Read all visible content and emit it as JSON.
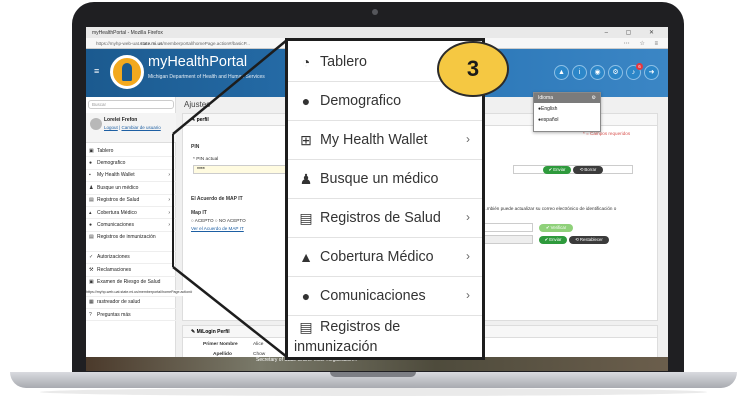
{
  "browser": {
    "window_title": "myHealthPortal - Mozilla Firefox",
    "window_controls": "– ▢ ✕",
    "url_prefix": "https://myhp-web-uat.",
    "url_domain": "state.mi.us",
    "url_path": "/memberportal/homePage.action#/basicP..."
  },
  "header": {
    "app_title": "myHealthPortal",
    "app_subtitle": "Michigan Department of Health and Human Services",
    "notification_count": "6"
  },
  "language_dropdown": {
    "title": "Idioma",
    "options": [
      "English",
      "español"
    ]
  },
  "sidebar": {
    "search_placeholder": "Buscar",
    "user_name": "Lorelei Frefon",
    "user_link_1": "Logout",
    "user_link_sep": "|",
    "user_link_2": "Cambiar de usuario",
    "items": [
      {
        "icon": "dashboard-icon",
        "label": "Tablero"
      },
      {
        "icon": "users-icon",
        "label": "Demografico"
      },
      {
        "icon": "wallet-icon",
        "label": "My Health Wallet",
        "arrow": "›"
      },
      {
        "icon": "doctor-icon",
        "label": "Busque un médico"
      },
      {
        "icon": "file-icon",
        "label": "Registros de Salud",
        "arrow": "›"
      },
      {
        "icon": "thumbs-up-icon",
        "label": "Cobertura Médico",
        "arrow": "›"
      },
      {
        "icon": "chat-icon",
        "label": "Comunicaciones",
        "arrow": "›"
      },
      {
        "icon": "file-icon",
        "label": "Registros de inmunización"
      },
      {
        "icon": "check-icon",
        "label": "Autorizaciones"
      },
      {
        "icon": "gavel-icon",
        "label": "Reclamaciones"
      },
      {
        "icon": "clipboard-icon",
        "label": "Examen de Riesgo de Salud"
      },
      {
        "icon": "tracker-icon",
        "label": "rastreador de salud"
      },
      {
        "icon": "question-icon",
        "label": "Preguntas más"
      }
    ],
    "status_url": "https://myhp-web-uat.state.mi.us/memberportal/homePage.action#"
  },
  "main": {
    "page_title": "Ajustes",
    "profile_panel_title": "perfil",
    "required_note": "* = Campos requeridos",
    "pin_section": "PIN",
    "pin_label": "* PIN actual",
    "pin_value": "****",
    "send_label": "✔ Enviar",
    "clear_label": "⟲ Borrar",
    "map_section": "El Acuerdo de MAP IT",
    "map_sub": "Map IT",
    "map_options": "○ ACEPTO ○ NO ACEPTO",
    "map_link": "Ver el Acuerdo de MAP IT",
    "email_text": "...mbién puede actualizar su correo electrónico de identificación o",
    "verify_label": "✔ Verificar",
    "send_label_2": "✔ Enviar",
    "reset_label": "⟲ Restablecer",
    "milogin_title": "MiLogin Perfil",
    "first_name_label": "Primer Nombre",
    "first_name_value": "Alice",
    "last_name_label": "Apellido",
    "last_name_value": "Chow",
    "footer_text": "Secretary of State Online Voter Registration..."
  },
  "zoom": {
    "items": [
      {
        "icon": "dashboard-icon",
        "label": "Tablero",
        "glyph": "🚗",
        "arrow": ""
      },
      {
        "icon": "users-icon",
        "label": "Demografico",
        "glyph": "👥",
        "arrow": ""
      },
      {
        "icon": "wallet-icon",
        "label": "My Health Wallet",
        "glyph": "✚",
        "arrow": "›"
      },
      {
        "icon": "doctor-icon",
        "label": "Busque un médico",
        "glyph": "♟",
        "arrow": ""
      },
      {
        "icon": "file-icon",
        "label": "Registros de Salud",
        "glyph": "▤",
        "arrow": "›"
      },
      {
        "icon": "thumbs-up-icon",
        "label": "Cobertura Médico",
        "glyph": "👍",
        "arrow": "›"
      },
      {
        "icon": "chat-icon",
        "label": "Comunicaciones",
        "glyph": "💬",
        "arrow": "›"
      }
    ],
    "last_item_line1": "Registros de",
    "last_item_line2": "inmunización"
  },
  "step_badge": "3",
  "colors": {
    "header_blue": "#2b76b6",
    "badge_yellow": "#f5c842",
    "logo_orange": "#f2a91f",
    "success_green": "#2e9a3c"
  }
}
